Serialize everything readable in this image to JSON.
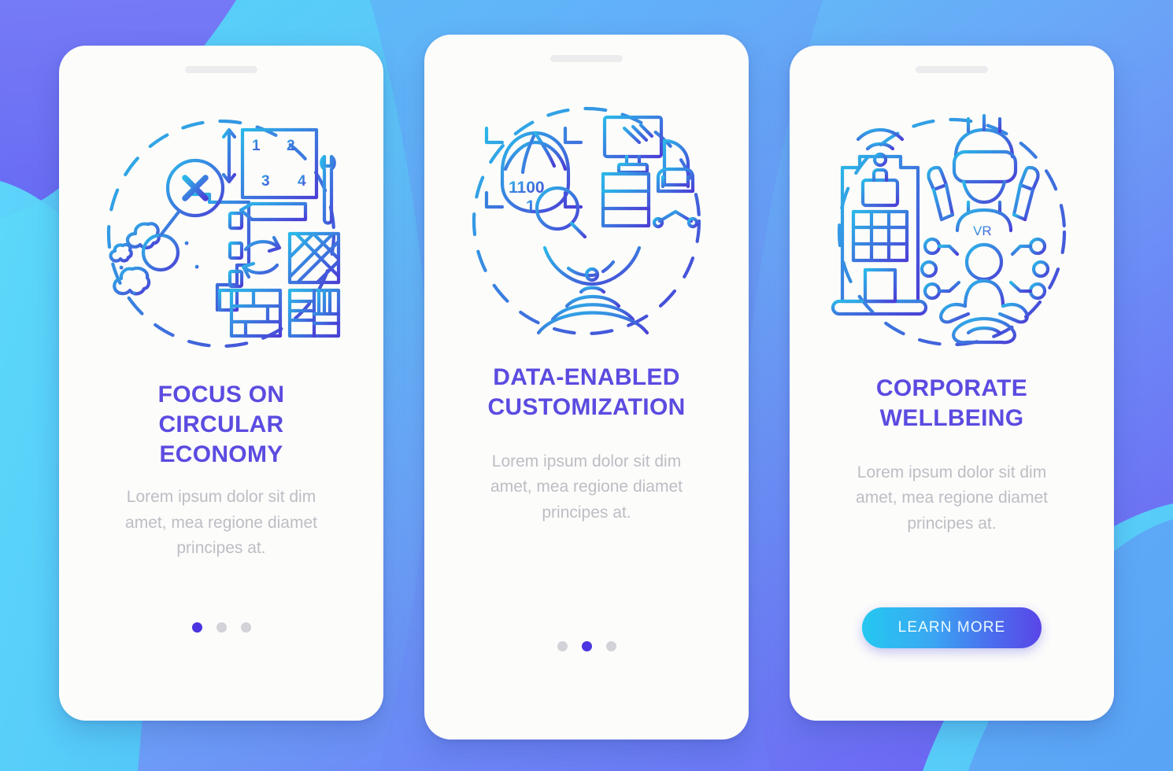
{
  "background": {
    "gradient_from": "#4FD4F7",
    "gradient_to": "#6A5BF2",
    "accent_cyan": "#5CD4F8",
    "accent_purple": "#6A5BF2"
  },
  "theme": {
    "title_color": "#5B4BE0",
    "body_color": "#BDBDC4",
    "dot_active_color": "#4B35E0",
    "dot_inactive_color": "#D2D2D8",
    "button_gradient_from": "#25C8F0",
    "button_gradient_to": "#5A46E8",
    "illustration_from": "#2BB8E8",
    "illustration_to": "#4B3FD6",
    "phone_body_color": "#FCFCFB",
    "speaker_color": "#ECECEE"
  },
  "screens": [
    {
      "id": "screen-circular-economy",
      "title": "FOCUS ON\nCIRCULAR\nECONOMY",
      "body": "Lorem ipsum dolor sit dim amet, mea regione diamet principes at.",
      "illustration": {
        "name": "circular-economy-illustration",
        "elements": [
          "demolished-building-icon",
          "cross-mark-icon",
          "dust-cloud-icon",
          "floor-plan-icon",
          "ruler-arrow-icon",
          "pencil-icon",
          "wrench-icon",
          "recycle-arrows-icon",
          "parquet-tile-icon",
          "brick-tile-icon",
          "plank-tile-icon"
        ],
        "floor_plan_labels": [
          "1",
          "2",
          "3",
          "4"
        ]
      },
      "pagination": {
        "total": 3,
        "active_index": 0
      },
      "button": null
    },
    {
      "id": "screen-data-enabled-customization",
      "title": "DATA-ENABLED\nCUSTOMIZATION",
      "body": "Lorem ipsum dolor sit dim amet, mea regione diamet principes at.",
      "illustration": {
        "name": "data-customization-illustration",
        "elements": [
          "face-scan-icon",
          "scan-bracket-icon",
          "magnifier-icon",
          "monitor-icon",
          "desk-drawers-icon",
          "office-chair-icon",
          "signal-waves-icon",
          "sensor-dome-icon"
        ],
        "binary_label": "1100\n1"
      },
      "pagination": {
        "total": 3,
        "active_index": 1
      },
      "button": null
    },
    {
      "id": "screen-corporate-wellbeing",
      "title": "CORPORATE\nWELLBEING",
      "body": "Lorem ipsum dolor sit dim amet, mea regione diamet principes at.",
      "illustration": {
        "name": "corporate-wellbeing-illustration",
        "elements": [
          "office-building-icon",
          "wifi-signal-icon",
          "briefcase-icon",
          "vr-headset-person-icon",
          "vr-controller-icon",
          "meditating-person-icon",
          "circuit-nodes-icon"
        ],
        "vr_label": "VR"
      },
      "pagination": null,
      "button": {
        "label": "LEARN MORE"
      }
    }
  ]
}
